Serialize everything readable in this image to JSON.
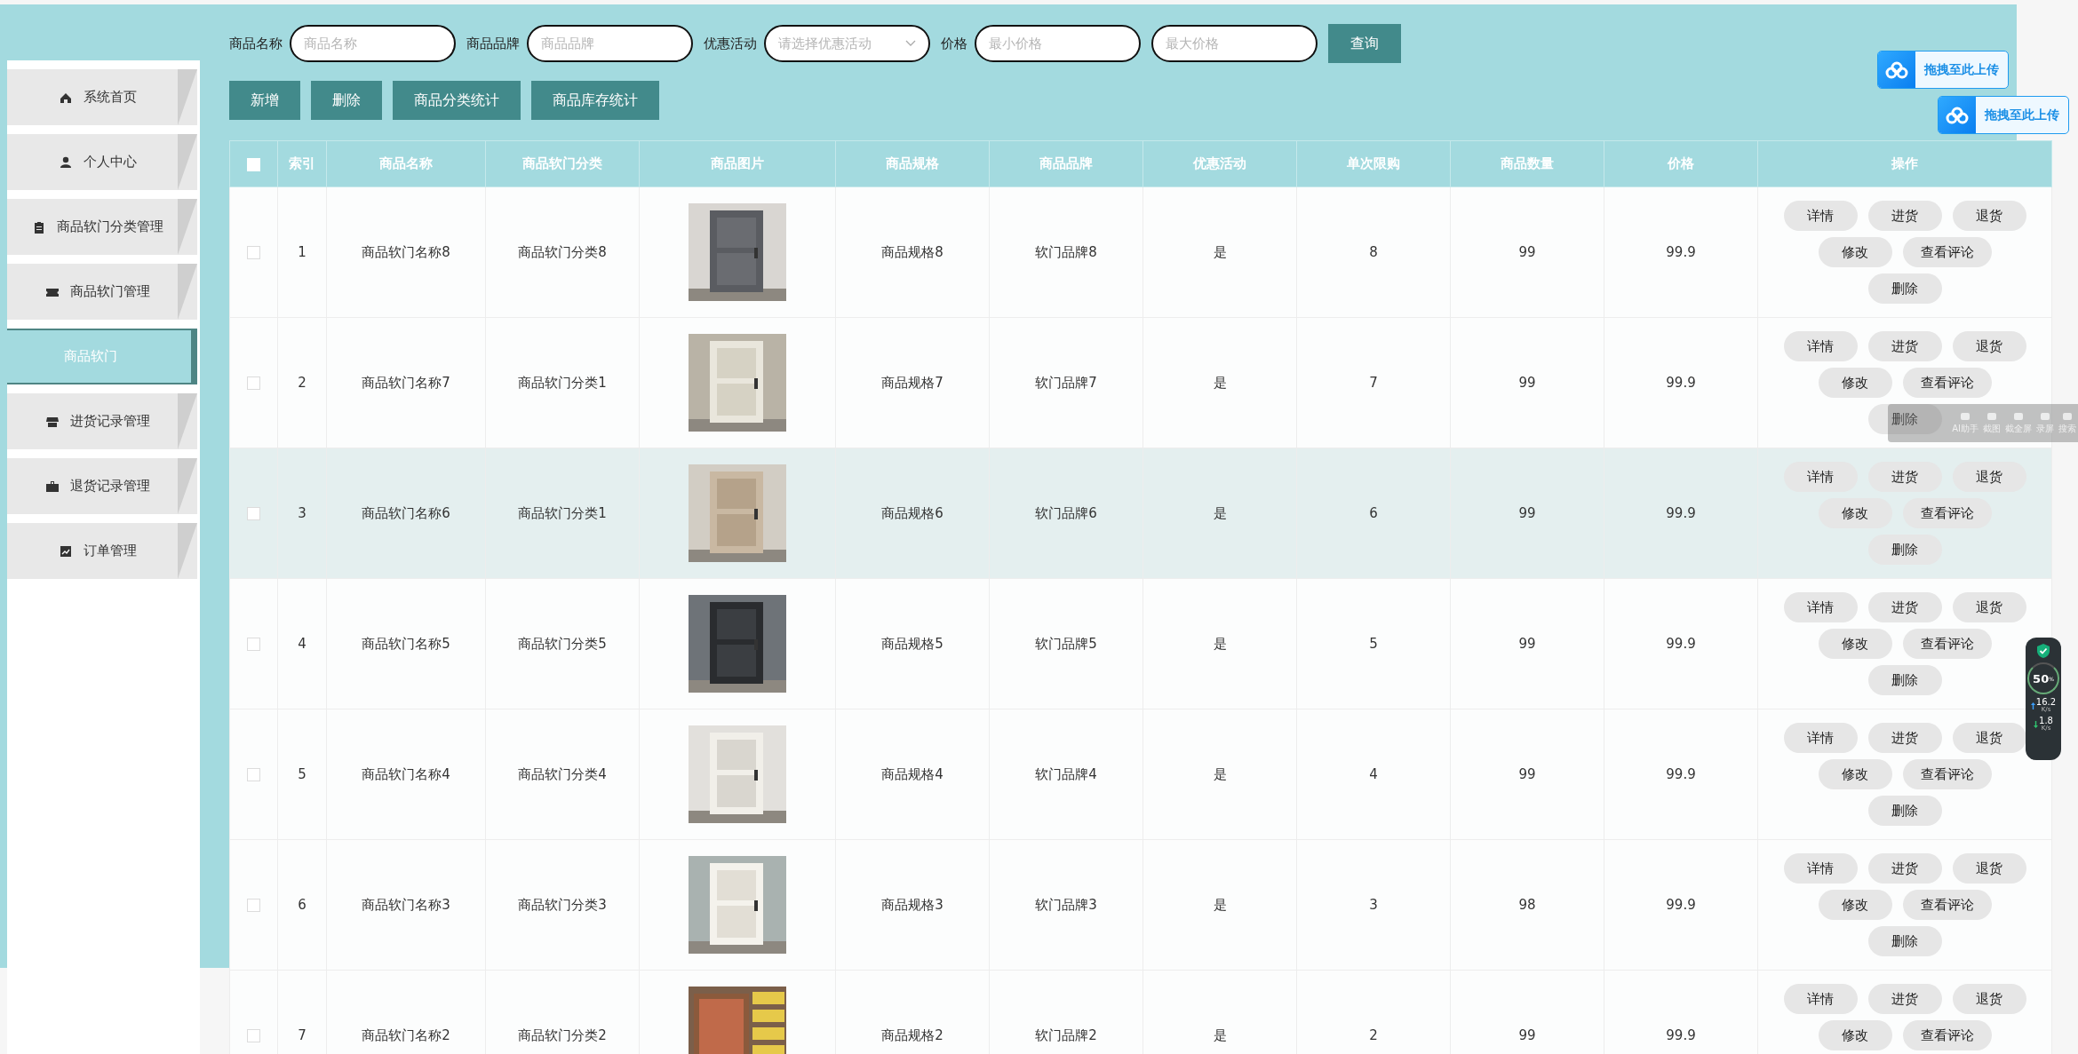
{
  "search": {
    "fields": [
      {
        "label": "商品名称",
        "placeholder": "商品名称",
        "kind": "text"
      },
      {
        "label": "商品品牌",
        "placeholder": "商品品牌",
        "kind": "text"
      },
      {
        "label": "优惠活动",
        "placeholder": "请选择优惠活动",
        "kind": "select"
      },
      {
        "label": "价格",
        "placeholder": "最小价格",
        "kind": "text"
      },
      {
        "placeholder": "最大价格",
        "kind": "text"
      }
    ],
    "button": "查询"
  },
  "toolbar": [
    "新增",
    "删除",
    "商品分类统计",
    "商品库存统计"
  ],
  "sidebar": {
    "items": [
      {
        "label": "系统首页",
        "kind": "menu",
        "selected": false
      },
      {
        "label": "个人中心",
        "kind": "menu",
        "selected": false
      },
      {
        "label": "商品软门分类管理",
        "kind": "menu",
        "selected": false
      },
      {
        "label": "商品软门管理",
        "kind": "menu",
        "selected": false
      },
      {
        "label": "商品软门",
        "kind": "submenu",
        "selected": true
      },
      {
        "label": "进货记录管理",
        "kind": "menu",
        "selected": false
      },
      {
        "label": "退货记录管理",
        "kind": "menu",
        "selected": false
      },
      {
        "label": "订单管理",
        "kind": "menu",
        "selected": false
      }
    ]
  },
  "table": {
    "select_all": {
      "checked": false
    },
    "columns": [
      "索引",
      "商品名称",
      "商品软门分类",
      "商品图片",
      "商品规格",
      "商品品牌",
      "优惠活动",
      "单次限购",
      "商品数量",
      "价格",
      "操作"
    ],
    "rows": [
      {
        "checked": false,
        "hovered": false,
        "index": "1",
        "name": "商品软门名称8",
        "category": "商品软门分类8",
        "spec": "商品规格8",
        "brand": "软门品牌8",
        "promo": "是",
        "limit": "8",
        "quantity": "99",
        "price": "99.9",
        "actions": [
          "详情",
          "进货",
          "退货",
          "修改",
          "查看评论",
          "删除"
        ]
      },
      {
        "checked": false,
        "hovered": false,
        "index": "2",
        "name": "商品软门名称7",
        "category": "商品软门分类1",
        "spec": "商品规格7",
        "brand": "软门品牌7",
        "promo": "是",
        "limit": "7",
        "quantity": "99",
        "price": "99.9",
        "actions": [
          "详情",
          "进货",
          "退货",
          "修改",
          "查看评论",
          "删除"
        ]
      },
      {
        "checked": false,
        "hovered": true,
        "index": "3",
        "name": "商品软门名称6",
        "category": "商品软门分类1",
        "spec": "商品规格6",
        "brand": "软门品牌6",
        "promo": "是",
        "limit": "6",
        "quantity": "99",
        "price": "99.9",
        "actions": [
          "详情",
          "进货",
          "退货",
          "修改",
          "查看评论",
          "删除"
        ]
      },
      {
        "checked": false,
        "hovered": false,
        "index": "4",
        "name": "商品软门名称5",
        "category": "商品软门分类5",
        "spec": "商品规格5",
        "brand": "软门品牌5",
        "promo": "是",
        "limit": "5",
        "quantity": "99",
        "price": "99.9",
        "actions": [
          "详情",
          "进货",
          "退货",
          "修改",
          "查看评论",
          "删除"
        ]
      },
      {
        "checked": false,
        "hovered": false,
        "index": "5",
        "name": "商品软门名称4",
        "category": "商品软门分类4",
        "spec": "商品规格4",
        "brand": "软门品牌4",
        "promo": "是",
        "limit": "4",
        "quantity": "99",
        "price": "99.9",
        "actions": [
          "详情",
          "进货",
          "退货",
          "修改",
          "查看评论",
          "删除"
        ]
      },
      {
        "checked": false,
        "hovered": false,
        "index": "6",
        "name": "商品软门名称3",
        "category": "商品软门分类3",
        "spec": "商品规格3",
        "brand": "软门品牌3",
        "promo": "是",
        "limit": "3",
        "quantity": "98",
        "price": "99.9",
        "actions": [
          "详情",
          "进货",
          "退货",
          "修改",
          "查看评论",
          "删除"
        ]
      },
      {
        "checked": false,
        "hovered": false,
        "index": "7",
        "name": "商品软门名称2",
        "category": "商品软门分类2",
        "spec": "商品规格2",
        "brand": "软门品牌2",
        "promo": "是",
        "limit": "2",
        "quantity": "99",
        "price": "99.9",
        "actions": [
          "详情",
          "进货",
          "退货",
          "修改",
          "查看评论"
        ]
      }
    ]
  },
  "upload_buttons": [
    "拖拽至此上传",
    "拖拽至此上传"
  ],
  "capture_toolbar": [
    "AI助手",
    "截图",
    "截全屏",
    "录屏",
    "搜索"
  ],
  "speed_widget": {
    "percent": "50",
    "percent_unit": "%",
    "upload": "16.2",
    "upload_unit": "K/s",
    "download": "1.8",
    "download_unit": "K/s"
  }
}
